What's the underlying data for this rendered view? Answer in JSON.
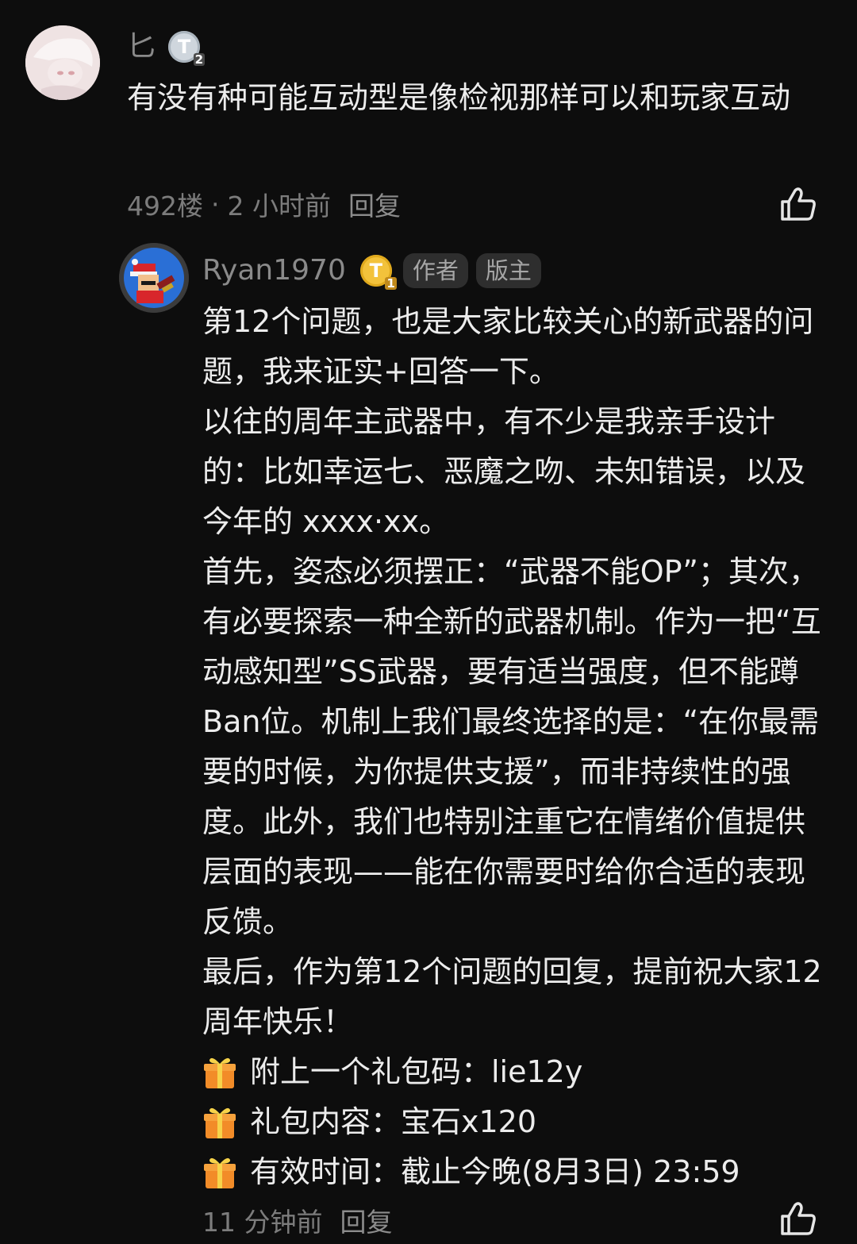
{
  "comment": {
    "username": "匕",
    "level_badge": "T",
    "level_num": "2",
    "text": "有没有种可能互动型是像检视那样可以和玩家互动",
    "floor": "492楼",
    "separator": "·",
    "time": "2 小时前",
    "reply_label": "回复"
  },
  "reply": {
    "username": "Ryan1970",
    "level_badge": "T",
    "level_num": "1",
    "tags": [
      "作者",
      "版主"
    ],
    "paragraphs": [
      "第12个问题，也是大家比较关心的新武器的问题，我来证实+回答一下。",
      "以往的周年主武器中，有不少是我亲手设计的：比如幸运七、恶魔之吻、未知错误，以及今年的 xxxx·xx。",
      "首先，姿态必须摆正：“武器不能OP”；其次，有必要探索一种全新的武器机制。作为一把“互动感知型”SS武器，要有适当强度，但不能蹲Ban位。机制上我们最终选择的是：“在你最需要的时候，为你提供支援”，而非持续性的强度。此外，我们也特别注重它在情绪价值提供层面的表现——能在你需要时给你合适的表现反馈。",
      "最后，作为第12个问题的回复，提前祝大家12周年快乐！"
    ],
    "gift_lines": [
      "附上一个礼包码：lie12y",
      "礼包内容：宝石x120",
      "有效时间：截止今晚(8月3日) 23:59"
    ],
    "time": "11 分钟前",
    "reply_label": "回复"
  },
  "icons": {
    "like": "thumbs-up-icon",
    "gift": "gift-icon"
  },
  "colors": {
    "background": "#0d0d0d",
    "text": "#ececec",
    "meta": "#7c7c7c",
    "tag_bg": "#2e2e2e",
    "gold_badge": "#f3c23b",
    "silver_badge": "#cfd6dd"
  }
}
